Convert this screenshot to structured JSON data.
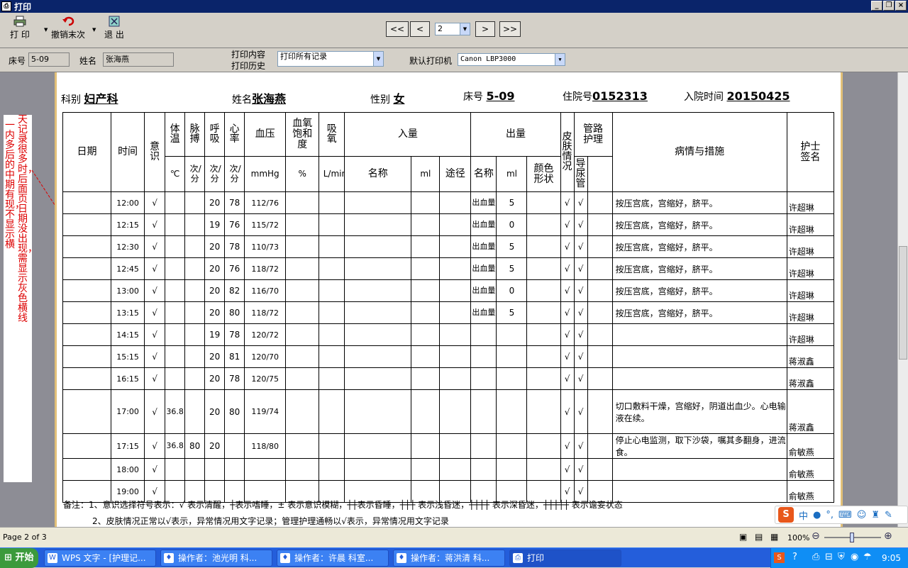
{
  "window": {
    "title": "打印",
    "minimize": "_",
    "restore": "❐",
    "close": "×"
  },
  "toolbar": {
    "print_label": "打 印",
    "undo_label": "撤销末次",
    "exit_label": "退 出",
    "first": "<<",
    "prev": "<",
    "page_value": "2",
    "next": ">",
    "last": ">>"
  },
  "info": {
    "bed_label": "床号",
    "bed_value": "5-09",
    "name_label": "姓名",
    "name_value": "张海燕",
    "content_label": "打印内容",
    "history_label": "打印历史",
    "content_value": "打印所有记录",
    "printer_label": "默认打印机",
    "printer_value": "Canon LBP3000"
  },
  "sticky_note": {
    "col1": "天记录很多时，后面页日期没出现，需显示灰色横线",
    "col2": "一内多后的中期有现，不显示横"
  },
  "sheet": {
    "dept_label": "科别",
    "dept_value": "妇产科",
    "name_label": "姓名",
    "name_value": "张海燕",
    "sex_label": "性别",
    "sex_value": "女",
    "bed_label": "床号",
    "bed_value": "5-09",
    "admission_no_label": "住院号",
    "admission_no_value": "0152313",
    "admit_time_label": "入院时间",
    "admit_time_value": "20150425",
    "col": {
      "date": "日期",
      "time": "时间",
      "conscious": "意识",
      "temp": "体温",
      "temp_unit": "℃",
      "pulse": "脉搏",
      "pulse_unit": "次/分",
      "resp": "呼吸",
      "resp_unit": "次/分",
      "hr": "心率",
      "hr_unit": "次/分",
      "bp": "血压",
      "bp_unit": "mmHg",
      "spo2": "血氧饱和度",
      "spo2_unit": "%",
      "o2": "吸氧",
      "o2_unit": "L/min",
      "intake": "入量",
      "intake_name": "名称",
      "intake_ml": "ml",
      "intake_route": "途径",
      "output": "出量",
      "output_name": "名称",
      "output_ml": "ml",
      "output_color": "颜色形状",
      "skin": "皮肤情况",
      "tube": "管路护理",
      "catheter": "导尿管",
      "condition": "病情与措施",
      "nurse": "护士签名"
    },
    "rows": [
      {
        "time": "12:00",
        "c": "√",
        "t": "",
        "p": "",
        "r": "20",
        "hr": "78",
        "bp": "112/76",
        "out_name": "出血量",
        "out_ml": "5",
        "skin": "√",
        "cath": "√",
        "cond": "按压宫底，宫缩好，脐平。",
        "nurse": "许超琳"
      },
      {
        "time": "12:15",
        "c": "√",
        "t": "",
        "p": "",
        "r": "19",
        "hr": "76",
        "bp": "115/72",
        "out_name": "出血量",
        "out_ml": "0",
        "skin": "√",
        "cath": "√",
        "cond": "按压宫底，宫缩好，脐平。",
        "nurse": "许超琳"
      },
      {
        "time": "12:30",
        "c": "√",
        "t": "",
        "p": "",
        "r": "20",
        "hr": "78",
        "bp": "110/73",
        "out_name": "出血量",
        "out_ml": "5",
        "skin": "√",
        "cath": "√",
        "cond": "按压宫底，宫缩好，脐平。",
        "nurse": "许超琳"
      },
      {
        "time": "12:45",
        "c": "√",
        "t": "",
        "p": "",
        "r": "20",
        "hr": "76",
        "bp": "118/72",
        "out_name": "出血量",
        "out_ml": "5",
        "skin": "√",
        "cath": "√",
        "cond": "按压宫底，宫缩好，脐平。",
        "nurse": "许超琳"
      },
      {
        "time": "13:00",
        "c": "√",
        "t": "",
        "p": "",
        "r": "20",
        "hr": "82",
        "bp": "116/70",
        "out_name": "出血量",
        "out_ml": "0",
        "skin": "√",
        "cath": "√",
        "cond": "按压宫底，宫缩好，脐平。",
        "nurse": "许超琳"
      },
      {
        "time": "13:15",
        "c": "√",
        "t": "",
        "p": "",
        "r": "20",
        "hr": "80",
        "bp": "118/72",
        "out_name": "出血量",
        "out_ml": "5",
        "skin": "√",
        "cath": "√",
        "cond": "按压宫底，宫缩好，脐平。",
        "nurse": "许超琳"
      },
      {
        "time": "14:15",
        "c": "√",
        "t": "",
        "p": "",
        "r": "19",
        "hr": "78",
        "bp": "120/72",
        "out_name": "",
        "out_ml": "",
        "skin": "√",
        "cath": "√",
        "cond": "",
        "nurse": "许超琳"
      },
      {
        "time": "15:15",
        "c": "√",
        "t": "",
        "p": "",
        "r": "20",
        "hr": "81",
        "bp": "120/70",
        "out_name": "",
        "out_ml": "",
        "skin": "√",
        "cath": "√",
        "cond": "",
        "nurse": "蒋淑鑫"
      },
      {
        "time": "16:15",
        "c": "√",
        "t": "",
        "p": "",
        "r": "20",
        "hr": "78",
        "bp": "120/75",
        "out_name": "",
        "out_ml": "",
        "skin": "√",
        "cath": "√",
        "cond": "",
        "nurse": "蒋淑鑫"
      },
      {
        "time": "17:00",
        "c": "√",
        "t": "36.8",
        "p": "",
        "r": "20",
        "hr": "80",
        "bp": "119/74",
        "out_name": "",
        "out_ml": "",
        "skin": "√",
        "cath": "√",
        "cond": "切口敷料干燥，宫缩好，阴道出血少。心电输液在续。",
        "nurse": "蒋淑鑫"
      },
      {
        "time": "17:15",
        "c": "√",
        "t": "36.8",
        "p": "80",
        "r": "20",
        "hr": "",
        "bp": "118/80",
        "out_name": "",
        "out_ml": "",
        "skin": "√",
        "cath": "√",
        "cond": "停止心电监测，取下沙袋，嘱其多翻身，进流食。",
        "nurse": "俞敏燕"
      },
      {
        "time": "18:00",
        "c": "√",
        "t": "",
        "p": "",
        "r": "",
        "hr": "",
        "bp": "",
        "out_name": "",
        "out_ml": "",
        "skin": "√",
        "cath": "√",
        "cond": "",
        "nurse": "俞敏燕"
      },
      {
        "time": "19:00",
        "c": "√",
        "t": "",
        "p": "",
        "r": "",
        "hr": "",
        "bp": "",
        "out_name": "",
        "out_ml": "",
        "skin": "√",
        "cath": "√",
        "cond": "",
        "nurse": "俞敏燕"
      }
    ],
    "note1": "备注：1、意识选择符号表示：√ 表示清醒，┼表示嗜睡，± 表示意识模糊，┼┼表示昏睡，┼┼┼ 表示浅昏迷，┼┼┼┼ 表示深昏迷，┼┼┼┼┼ 表示谵妄状态",
    "note2": "2、皮肤情况正常以√表示，异常情况用文字记录；管理护理通畅以√表示，异常情况用文字记录"
  },
  "status": {
    "page": "Page 2 of 3",
    "zoom": "100%"
  },
  "taskbar": {
    "start": "开始",
    "tasks": [
      "WPS 文字 - [护理记...",
      "操作者：池光明  科...",
      "操作者：许晨  科室...",
      "操作者：蒋洪清  科...",
      "打印"
    ],
    "clock": "9:05"
  },
  "ime": {
    "mode": "中"
  }
}
